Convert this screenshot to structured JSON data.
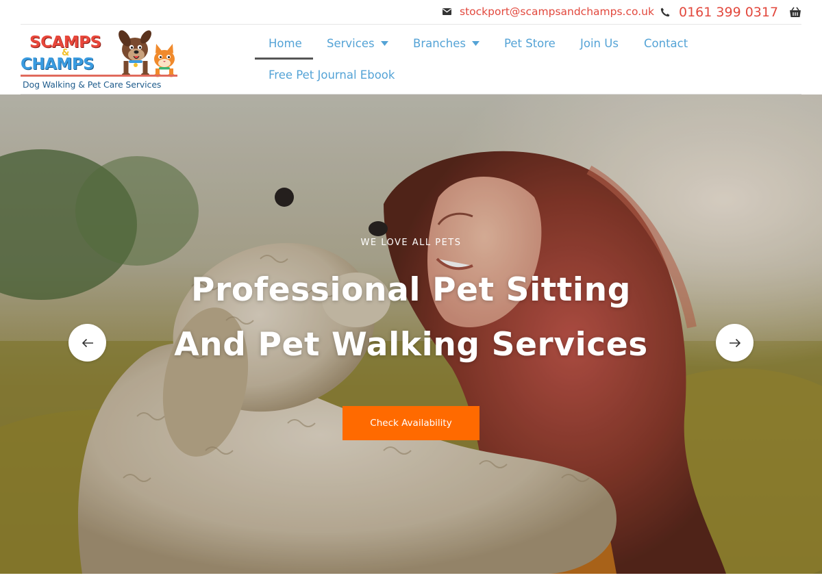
{
  "topbar": {
    "email": "stockport@scampsandchamps.co.uk",
    "phone": "0161 399 0317",
    "email_icon": "envelope-icon",
    "phone_icon": "phone-icon",
    "cart_icon": "shopping-basket-icon"
  },
  "logo": {
    "line1": "SCAMPS",
    "amp": "&",
    "line2": "CHAMPS",
    "tagline": "Dog Walking & Pet Care Services"
  },
  "nav": {
    "items": [
      {
        "label": "Home",
        "active": true,
        "has_dropdown": false
      },
      {
        "label": "Services",
        "active": false,
        "has_dropdown": true
      },
      {
        "label": "Branches",
        "active": false,
        "has_dropdown": true
      },
      {
        "label": "Pet Store",
        "active": false,
        "has_dropdown": false
      },
      {
        "label": "Join Us",
        "active": false,
        "has_dropdown": false
      },
      {
        "label": "Contact",
        "active": false,
        "has_dropdown": false
      },
      {
        "label": "Free Pet Journal Ebook",
        "active": false,
        "has_dropdown": false
      }
    ]
  },
  "hero": {
    "kicker": "WE LOVE ALL PETS",
    "headline_line1": "Professional Pet Sitting",
    "headline_line2": "And Pet Walking Services",
    "cta_label": "Check Availability",
    "prev_icon": "arrow-left-icon",
    "next_icon": "arrow-right-icon"
  },
  "colors": {
    "accent_red": "#e2483d",
    "nav_blue": "#54a3d6",
    "cta_orange": "#ff6a00"
  }
}
